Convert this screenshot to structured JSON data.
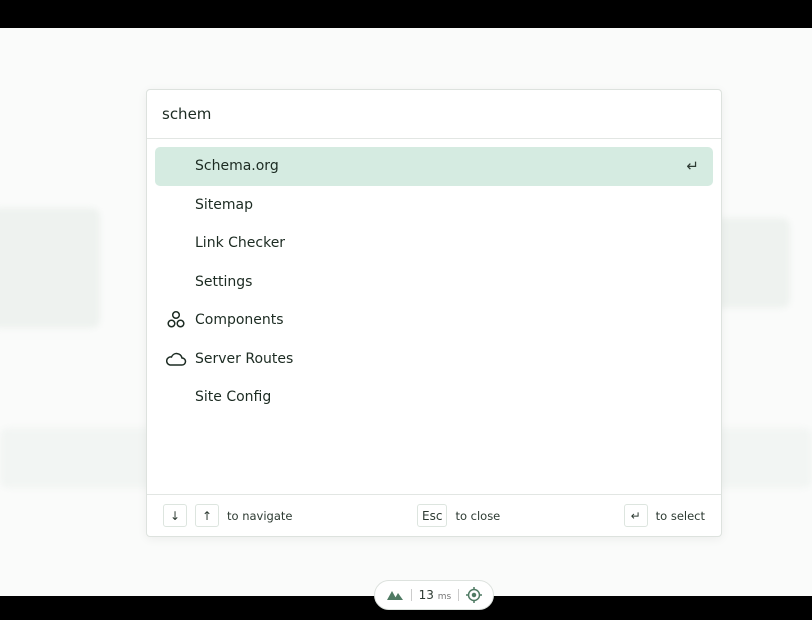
{
  "search": {
    "value": "schem"
  },
  "items": [
    {
      "label": "Schema.org",
      "icon": null,
      "active": true
    },
    {
      "label": "Sitemap",
      "icon": null
    },
    {
      "label": "Link Checker",
      "icon": null
    },
    {
      "label": "Settings",
      "icon": null
    },
    {
      "label": "Components",
      "icon": "components-icon"
    },
    {
      "label": "Server Routes",
      "icon": "cloud-icon"
    },
    {
      "label": "Site Config",
      "icon": null
    }
  ],
  "enter_glyph": "↵",
  "footer": {
    "down": "↓",
    "up": "↑",
    "navigate": "to navigate",
    "esc": "Esc",
    "close": "to close",
    "enter": "↵",
    "select": "to select"
  },
  "devbar": {
    "time": "13",
    "unit": "ms"
  }
}
